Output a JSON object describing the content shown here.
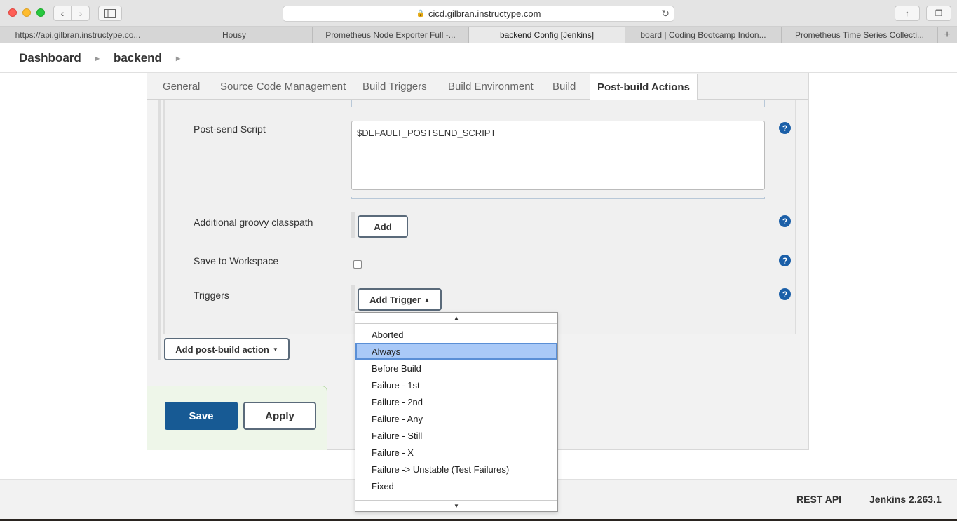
{
  "browser": {
    "url": "cicd.gilbran.instructype.com",
    "tabs": [
      {
        "label": "https://api.gilbran.instructype.co..."
      },
      {
        "label": "Housy"
      },
      {
        "label": "Prometheus Node Exporter Full -..."
      },
      {
        "label": "backend Config [Jenkins]"
      },
      {
        "label": "board | Coding Bootcamp Indon..."
      },
      {
        "label": "Prometheus Time Series Collecti..."
      }
    ],
    "active_tab_index": 3
  },
  "breadcrumb": {
    "items": [
      "Dashboard",
      "backend"
    ]
  },
  "config_tabs": [
    "General",
    "Source Code Management",
    "Build Triggers",
    "Build Environment",
    "Build",
    "Post-build Actions"
  ],
  "active_config_tab": "Post-build Actions",
  "form": {
    "postsend_label": "Post-send Script",
    "postsend_value": "$DEFAULT_POSTSEND_SCRIPT",
    "classpath_label": "Additional groovy classpath",
    "add_label": "Add",
    "workspace_label": "Save to Workspace",
    "triggers_label": "Triggers",
    "add_trigger_label": "Add Trigger",
    "add_post_build_label": "Add post-build action",
    "help_glyph": "?"
  },
  "actions": {
    "save_label": "Save",
    "apply_label": "Apply"
  },
  "trigger_menu": {
    "items": [
      "Aborted",
      "Always",
      "Before Build",
      "Failure - 1st",
      "Failure - 2nd",
      "Failure - Any",
      "Failure - Still",
      "Failure - X",
      "Failure -> Unstable (Test Failures)",
      "Fixed"
    ],
    "highlighted": "Always"
  },
  "footer": {
    "rest_api": "REST API",
    "version": "Jenkins 2.263.1"
  },
  "colors": {
    "primary": "#175a94",
    "help": "#1b5fa8",
    "highlight": "#a9c9f7"
  }
}
